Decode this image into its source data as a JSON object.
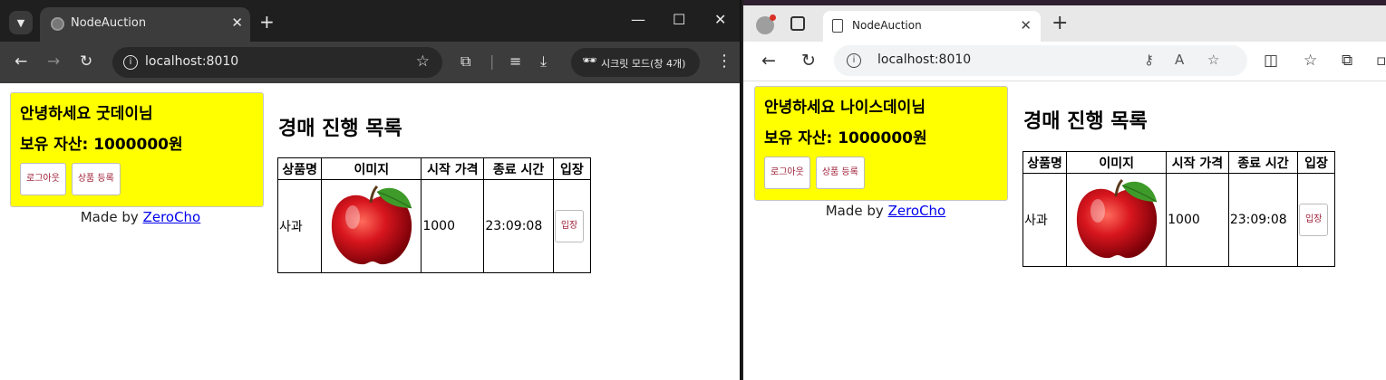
{
  "chrome": {
    "tab_title": "NodeAuction",
    "url": "localhost:8010",
    "incognito_label": "시크릿 모드(창 4개)"
  },
  "edge": {
    "tab_title": "NodeAuction",
    "url": "localhost:8010"
  },
  "left_page": {
    "greeting": "안녕하세요 굿데이님",
    "money": "보유 자산: 1000000원",
    "logout_label": "로그아웃",
    "register_label": "상품 등록",
    "madeby_prefix": "Made by ",
    "madeby_link": "ZeroCho",
    "list_title": "경매 진행 목록",
    "columns": [
      "상품명",
      "이미지",
      "시작 가격",
      "종료 시간",
      "입장"
    ],
    "row": {
      "name": "사과",
      "price": "1000",
      "end_time": "23:09:08",
      "enter_label": "입장"
    }
  },
  "right_page": {
    "greeting": "안녕하세요 나이스데이님",
    "money": "보유 자산: 1000000원",
    "logout_label": "로그아웃",
    "register_label": "상품 등록",
    "madeby_prefix": "Made by ",
    "madeby_link": "ZeroCho",
    "list_title": "경매 진행 목록",
    "columns": [
      "상품명",
      "이미지",
      "시작 가격",
      "종료 시간",
      "입장"
    ],
    "row": {
      "name": "사과",
      "price": "1000",
      "end_time": "23:09:08",
      "enter_label": "입장"
    }
  },
  "colors": {
    "userbox_bg": "#ffff00",
    "button_text": "#a0223a",
    "link": "#0000ee"
  }
}
